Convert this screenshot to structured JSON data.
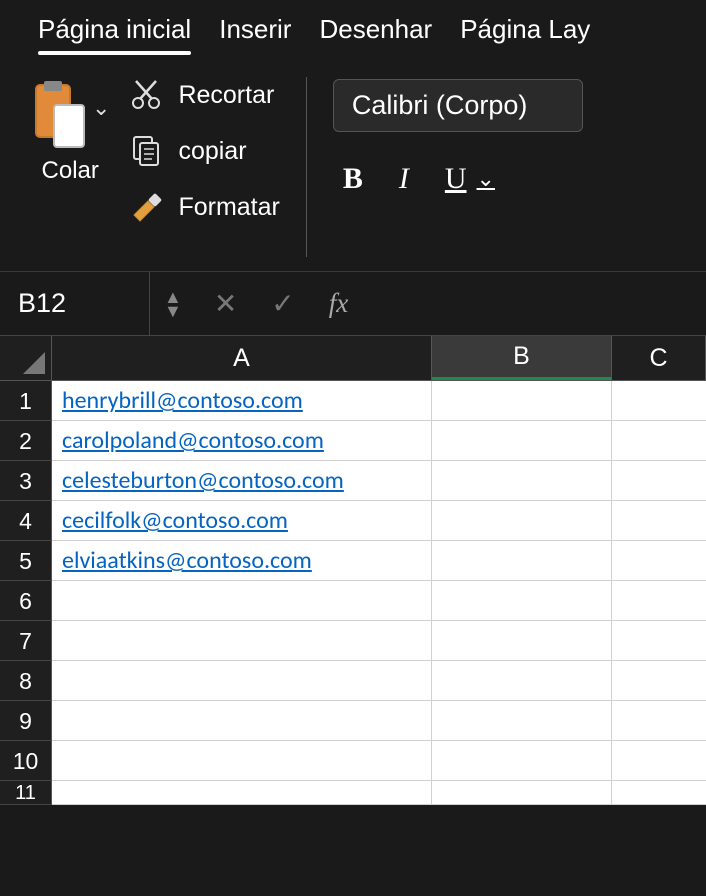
{
  "tabs": {
    "home": "Página inicial",
    "insert": "Inserir",
    "draw": "Desenhar",
    "layout": "Página Lay"
  },
  "ribbon": {
    "paste": "Colar",
    "cut": "Recortar",
    "copy": "copiar",
    "format": "Formatar",
    "font_name": "Calibri (Corpo)",
    "bold": "B",
    "italic": "I",
    "underline": "U"
  },
  "namebox": "B12",
  "fx": "fx",
  "columns": {
    "A": "A",
    "B": "B",
    "C": "C"
  },
  "rows": [
    {
      "num": "1",
      "A": "henrybrill@contoso.com"
    },
    {
      "num": "2",
      "A": "carolpoland@contoso.com"
    },
    {
      "num": "3",
      "A": "celesteburton@contoso.com"
    },
    {
      "num": "4",
      "A": "cecilfolk@contoso.com"
    },
    {
      "num": "5",
      "A": "elviaatkins@contoso.com"
    },
    {
      "num": "6",
      "A": ""
    },
    {
      "num": "7",
      "A": ""
    },
    {
      "num": "8",
      "A": ""
    },
    {
      "num": "9",
      "A": ""
    },
    {
      "num": "10",
      "A": ""
    },
    {
      "num": "11",
      "A": ""
    }
  ]
}
